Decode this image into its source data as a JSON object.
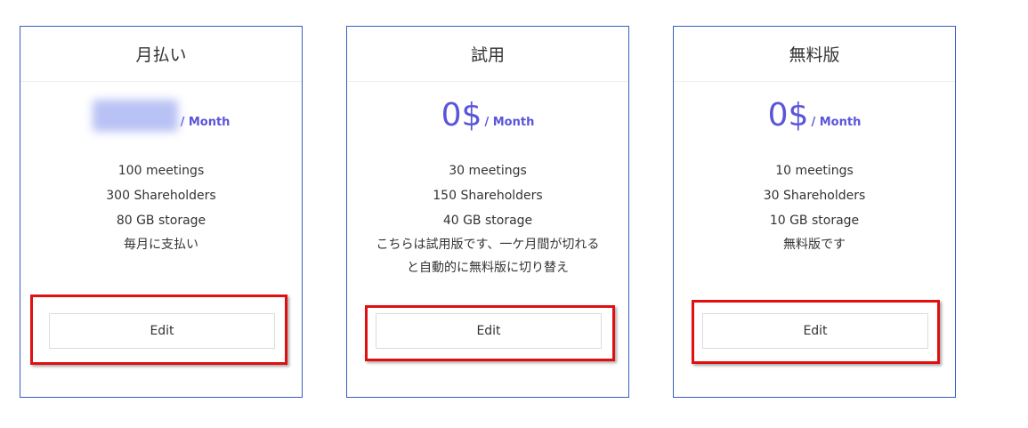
{
  "plans": [
    {
      "title": "月払い",
      "price": "",
      "price_hidden": true,
      "unit": "/ Month",
      "features": [
        "100 meetings",
        "300 Shareholders",
        "80 GB storage"
      ],
      "description": "毎月に支払い",
      "button_label": "Edit"
    },
    {
      "title": "試用",
      "price": "0$",
      "price_hidden": false,
      "unit": "/ Month",
      "features": [
        "30 meetings",
        "150 Shareholders",
        "40 GB storage"
      ],
      "description": "こちらは試用版です、一ケ月間が切れると自動的に無料版に切り替え",
      "button_label": "Edit"
    },
    {
      "title": "無料版",
      "price": "0$",
      "price_hidden": false,
      "unit": "/ Month",
      "features": [
        "10 meetings",
        "30 Shareholders",
        "10 GB storage"
      ],
      "description": "無料版です",
      "button_label": "Edit"
    }
  ],
  "colors": {
    "accent": "#5a55d9",
    "card_border": "#3a5ec0",
    "highlight": "#e01010"
  }
}
